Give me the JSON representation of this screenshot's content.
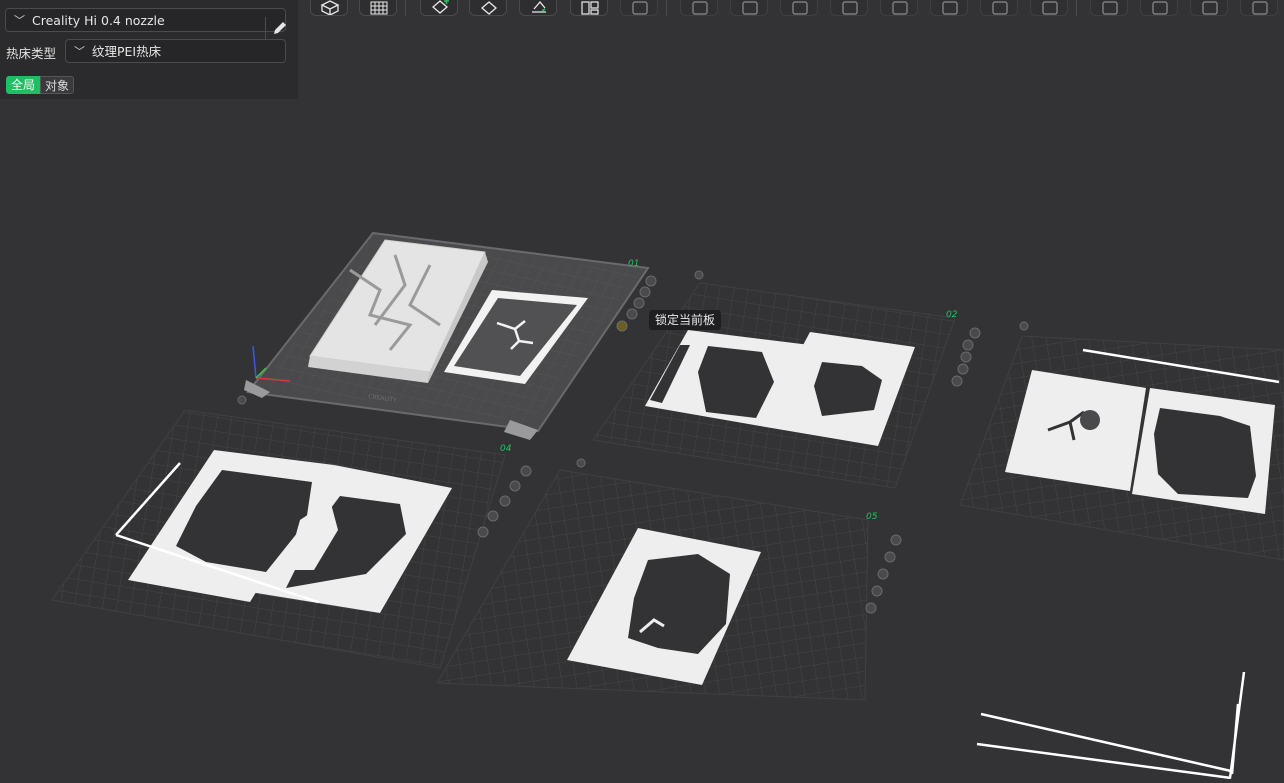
{
  "config_panel": {
    "printer": {
      "value": "Creality Hi 0.4 nozzle",
      "chevron_icon": "chevron-down-icon",
      "edit_icon": "pencil-icon"
    },
    "bed_type": {
      "label": "热床类型",
      "value": "纹理PEI热床",
      "chevron_icon": "chevron-down-icon"
    },
    "scope_tabs": {
      "global": "全局",
      "object": "对象",
      "active": "global"
    }
  },
  "toolbar": {
    "tools": [
      {
        "icon": "view-cube-icon"
      },
      {
        "icon": "grid-plate-icon"
      },
      {
        "icon": "add-object-icon"
      },
      {
        "icon": "orient-icon"
      },
      {
        "icon": "lay-flat-icon"
      },
      {
        "icon": "arrange-icon"
      },
      {
        "icon": "auto-arrange-icon"
      },
      {
        "icon": "split-objects-icon"
      },
      {
        "icon": "split-parts-icon"
      },
      {
        "icon": "cut-icon"
      },
      {
        "icon": "layers-icon"
      },
      {
        "icon": "support-paint-icon"
      },
      {
        "icon": "seam-paint-icon"
      },
      {
        "icon": "mesh-boolean-icon"
      },
      {
        "icon": "measure-icon"
      },
      {
        "icon": "text-emboss-icon"
      },
      {
        "icon": "svg-emboss-icon"
      },
      {
        "icon": "variable-layer-icon"
      },
      {
        "icon": "assembly-icon"
      }
    ]
  },
  "plates": [
    {
      "number": "01",
      "selected": true
    },
    {
      "number": "02",
      "selected": false
    },
    {
      "number": "03",
      "selected": false
    },
    {
      "number": "04",
      "selected": false
    },
    {
      "number": "05",
      "selected": false
    }
  ],
  "plate_tools": [
    "close-icon",
    "arrange-icon",
    "orient-icon",
    "lock-icon",
    "settings-icon"
  ],
  "plate_brand": "CREALITY",
  "tooltip": {
    "text": "锁定当前板"
  },
  "colors": {
    "accent": "#1dbf62",
    "plate_number": "#22c55e",
    "viewport": "#333336",
    "model": "#ededed"
  }
}
